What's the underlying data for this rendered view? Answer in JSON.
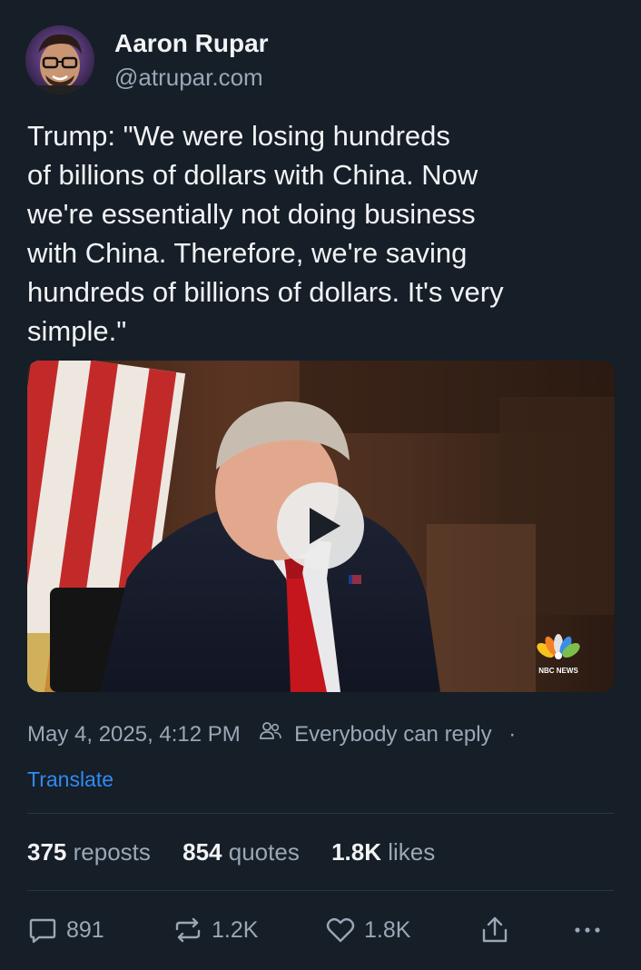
{
  "author": {
    "name": "Aaron Rupar",
    "handle": "@atrupar.com"
  },
  "post": {
    "text": "Trump: \"We were losing hundreds\nof billions of dollars with China. Now\nwe're essentially not doing business\nwith China. Therefore, we're saving\nhundreds of billions of dollars. It's very\nsimple.\""
  },
  "video": {
    "watermark": "NBC NEWS",
    "play_icon": "play-icon"
  },
  "meta": {
    "timestamp": "May 4, 2025, 4:12 PM",
    "reply_setting": "Everybody can reply",
    "separator": "·",
    "translate_label": "Translate"
  },
  "stats": {
    "reposts_count": "375",
    "reposts_label": "reposts",
    "quotes_count": "854",
    "quotes_label": "quotes",
    "likes_count": "1.8K",
    "likes_label": "likes"
  },
  "actions": {
    "reply_count": "891",
    "repost_count": "1.2K",
    "like_count": "1.8K",
    "icons": [
      "reply-icon",
      "repost-icon",
      "like-icon",
      "share-icon",
      "more-icon"
    ]
  },
  "colors": {
    "background": "#161e27",
    "text_primary": "#f1f3f5",
    "text_secondary": "#9aa7b6",
    "link": "#2f8bf5"
  }
}
